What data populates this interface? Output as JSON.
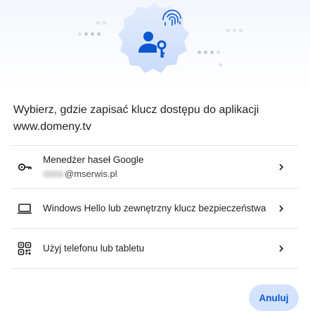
{
  "dialog": {
    "title": "Wybierz, gdzie zapisać klucz dostępu do aplikacji www.domeny.tv"
  },
  "options": [
    {
      "label": "Menedżer haseł Google",
      "account_domain": "@mserwis.pl",
      "icon": "key-icon"
    },
    {
      "label": "Windows Hello lub zewnętrzny klucz bezpieczeństwa",
      "icon": "laptop-icon"
    },
    {
      "label": "Użyj telefonu lub tabletu",
      "icon": "qr-code-icon"
    }
  ],
  "buttons": {
    "cancel": "Anuluj"
  },
  "colors": {
    "accent": "#0b57d0",
    "button_bg": "#d3e3fd",
    "badge_bg": "#d3e3fd",
    "divider": "#e3e3e3"
  }
}
